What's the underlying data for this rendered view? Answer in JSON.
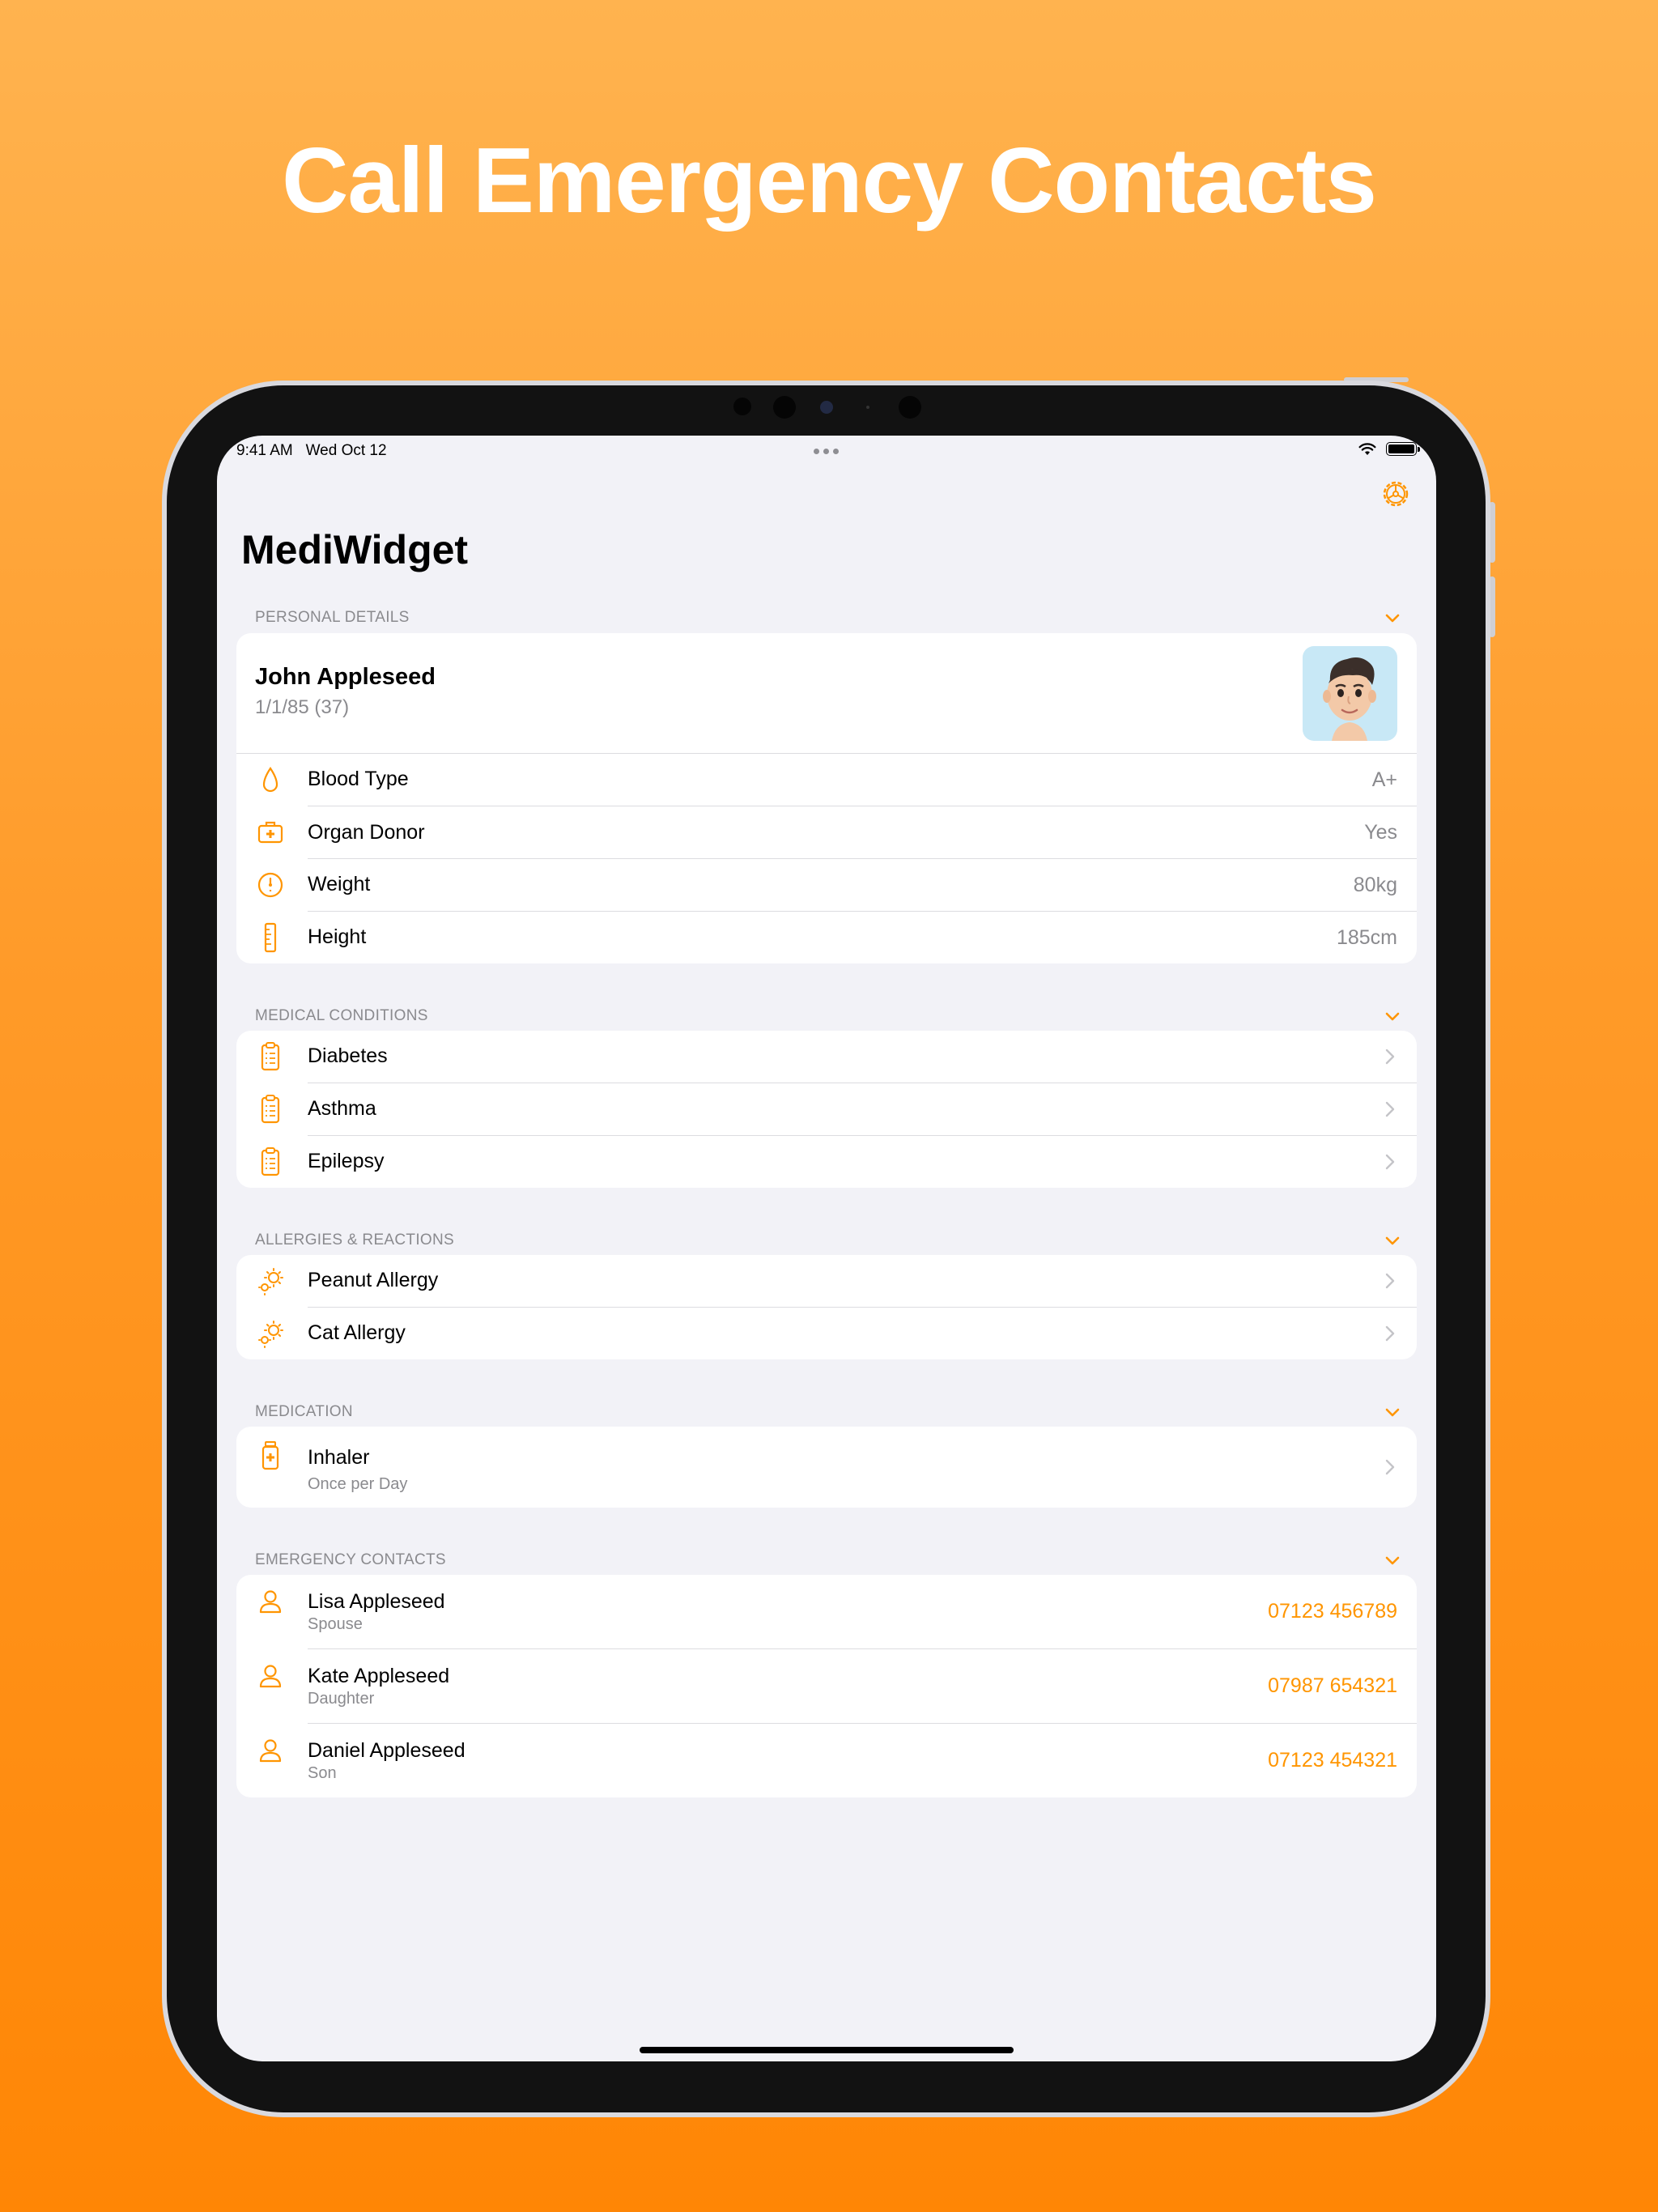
{
  "headline": "Call Emergency Contacts",
  "colors": {
    "accent": "#FF9500",
    "background_top": "#FFB34F",
    "background_bottom": "#FF8605"
  },
  "status_bar": {
    "time": "9:41 AM",
    "date": "Wed Oct 12"
  },
  "app": {
    "title": "MediWidget",
    "settings_icon": "gear-icon"
  },
  "personal_details": {
    "header": "PERSONAL DETAILS",
    "name": "John Appleseed",
    "dob": "1/1/85 (37)",
    "rows": [
      {
        "icon": "drop-icon",
        "label": "Blood Type",
        "value": "A+"
      },
      {
        "icon": "medical-kit-icon",
        "label": "Organ Donor",
        "value": "Yes"
      },
      {
        "icon": "scale-icon",
        "label": "Weight",
        "value": "80kg"
      },
      {
        "icon": "ruler-icon",
        "label": "Height",
        "value": "185cm"
      }
    ]
  },
  "medical_conditions": {
    "header": "MEDICAL CONDITIONS",
    "items": [
      {
        "icon": "clipboard-icon",
        "label": "Diabetes"
      },
      {
        "icon": "clipboard-icon",
        "label": "Asthma"
      },
      {
        "icon": "clipboard-icon",
        "label": "Epilepsy"
      }
    ]
  },
  "allergies": {
    "header": "ALLERGIES & REACTIONS",
    "items": [
      {
        "icon": "allergen-icon",
        "label": "Peanut Allergy"
      },
      {
        "icon": "allergen-icon",
        "label": "Cat Allergy"
      }
    ]
  },
  "medication": {
    "header": "MEDICATION",
    "items": [
      {
        "icon": "pill-bottle-icon",
        "label": "Inhaler",
        "frequency": "Once per Day"
      }
    ]
  },
  "emergency_contacts": {
    "header": "EMERGENCY CONTACTS",
    "items": [
      {
        "icon": "person-icon",
        "name": "Lisa Appleseed",
        "relation": "Spouse",
        "phone": "07123 456789"
      },
      {
        "icon": "person-icon",
        "name": "Kate Appleseed",
        "relation": "Daughter",
        "phone": "07987 654321"
      },
      {
        "icon": "person-icon",
        "name": "Daniel Appleseed",
        "relation": "Son",
        "phone": "07123 454321"
      }
    ]
  }
}
